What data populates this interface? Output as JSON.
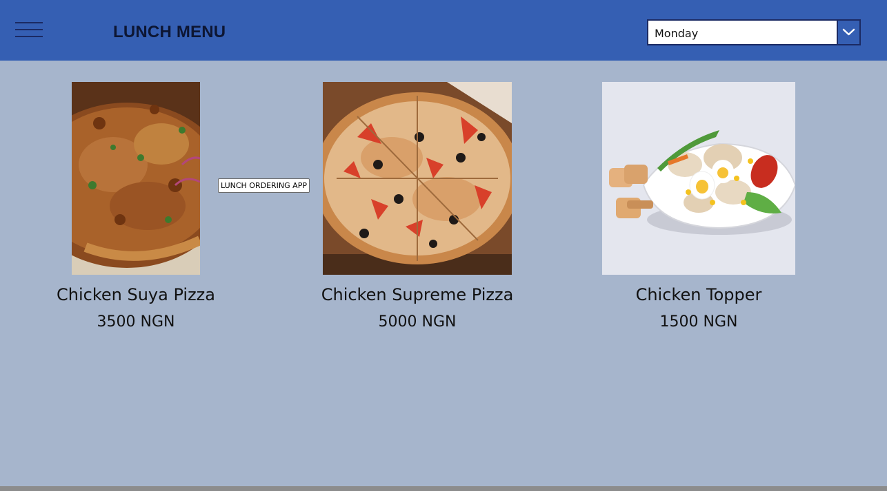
{
  "header": {
    "title": "LUNCH MENU",
    "day_select": {
      "selected": "Monday"
    },
    "colors": {
      "bar": "#355fb3",
      "accent": "#1b2a63"
    }
  },
  "tooltip": "LUNCH ORDERING APP",
  "menu": {
    "items": [
      {
        "name": "Chicken Suya Pizza",
        "price": "3500 NGN",
        "image": "pizza-image"
      },
      {
        "name": "Chicken Supreme Pizza",
        "price": "5000 NGN",
        "image": "pizza-image"
      },
      {
        "name": "Chicken Topper",
        "price": "1500 NGN",
        "image": "salad-image"
      }
    ]
  },
  "icons": [
    "hamburger-menu-icon",
    "chevron-down-icon"
  ],
  "page_background": "#a6b5cc"
}
